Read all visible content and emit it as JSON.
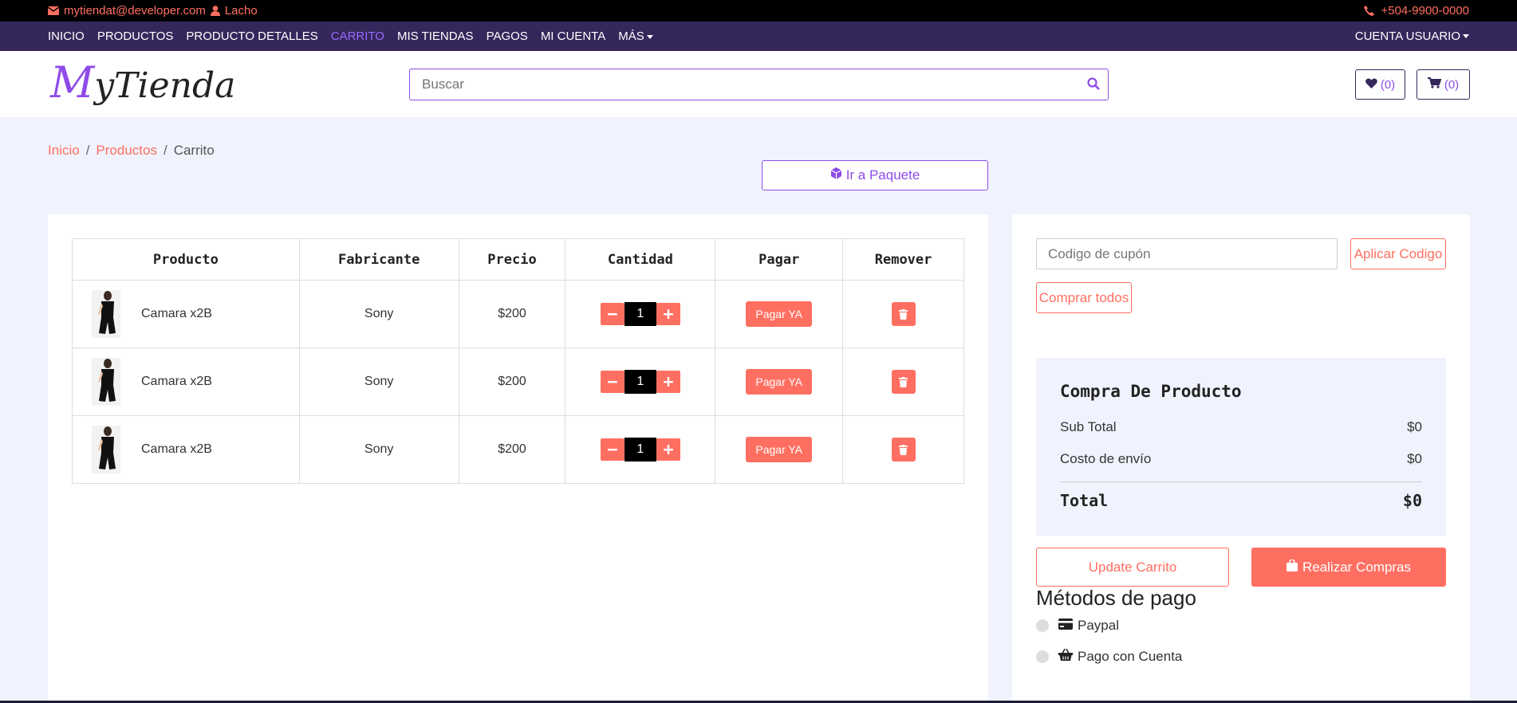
{
  "topbar": {
    "email": "mytiendat@developer.com",
    "user": "Lacho",
    "phone": "+504-9900-0000"
  },
  "nav": {
    "items": [
      {
        "label": "INICIO"
      },
      {
        "label": "PRODUCTOS"
      },
      {
        "label": "PRODUCTO DETALLES"
      },
      {
        "label": "CARRITO",
        "active": true
      },
      {
        "label": "MIS TIENDAS"
      },
      {
        "label": "PAGOS"
      },
      {
        "label": "MI CUENTA"
      },
      {
        "label": "MÁS"
      }
    ],
    "account": "CUENTA USUARIO"
  },
  "header": {
    "logo_first": "M",
    "logo_rest": "yTienda",
    "search_placeholder": "Buscar",
    "wishlist_count": "(0)",
    "cart_count": "(0)"
  },
  "breadcrumb": {
    "items": [
      "Inicio",
      "Productos",
      "Carrito"
    ],
    "separator": "/"
  },
  "paquete_button": "Ir a Paquete",
  "table": {
    "headers": [
      "Producto",
      "Fabricante",
      "Precio",
      "Cantidad",
      "Pagar",
      "Remover"
    ],
    "rows": [
      {
        "name": "Camara x2B",
        "maker": "Sony",
        "price": "$200",
        "qty": "1",
        "pay": "Pagar YA"
      },
      {
        "name": "Camara x2B",
        "maker": "Sony",
        "price": "$200",
        "qty": "1",
        "pay": "Pagar YA"
      },
      {
        "name": "Camara x2B",
        "maker": "Sony",
        "price": "$200",
        "qty": "1",
        "pay": "Pagar YA"
      }
    ]
  },
  "sidebar": {
    "coupon_placeholder": "Codigo de cupón",
    "apply_label": "Aplicar Codigo",
    "buy_all_label": "Comprar todos",
    "summary": {
      "title": "Compra De Producto",
      "subtotal_label": "Sub Total",
      "subtotal_value": "$0",
      "shipping_label": "Costo de envío",
      "shipping_value": "$0",
      "total_label": "Total",
      "total_value": "$0"
    },
    "update_label": "Update Carrito",
    "checkout_label": "Realizar Compras",
    "payment_title": "Métodos de pago",
    "payment_methods": [
      "Paypal",
      "Pago con Cuenta"
    ]
  },
  "colors": {
    "accent": "#8e4be8",
    "coral": "#ff6f61",
    "nav_bg": "#35275b",
    "page_bg": "#f0f3fd"
  },
  "icons": [
    "envelope-icon",
    "user-icon",
    "phone-icon",
    "search-icon",
    "heart-icon",
    "cart-icon",
    "cube-icon",
    "minus-icon",
    "plus-icon",
    "trash-icon",
    "bag-icon",
    "credit-card-icon",
    "basket-icon"
  ]
}
